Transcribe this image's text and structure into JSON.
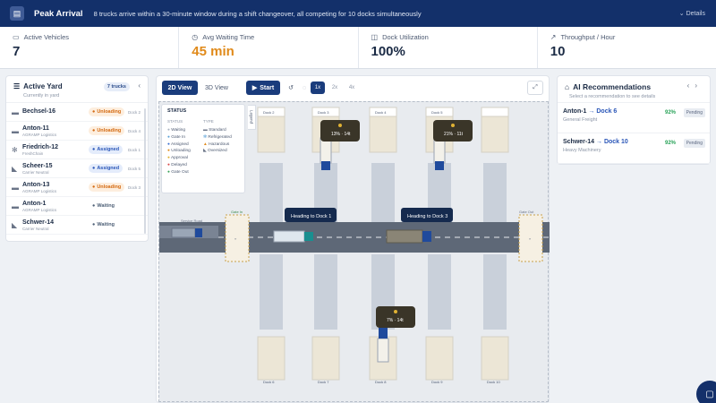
{
  "banner": {
    "title": "Peak Arrival",
    "text": "8 trucks arrive within a 30-minute window during a shift changeover, all competing for 10 docks simultaneously",
    "details": "Details"
  },
  "stats": [
    {
      "label": "Active Vehicles",
      "value": "7",
      "icon": "truck-icon"
    },
    {
      "label": "Avg Waiting Time",
      "value": "45 min",
      "icon": "clock-icon",
      "color": "#e08a1a"
    },
    {
      "label": "Dock Utilization",
      "value": "100%",
      "icon": "dock-icon"
    },
    {
      "label": "Throughput / Hour",
      "value": "10",
      "icon": "trend-icon"
    }
  ],
  "left_panel": {
    "title": "Active Yard",
    "subtitle": "Currently in yard",
    "badge": "7 trucks",
    "trucks": [
      {
        "name": "Bechsel-16",
        "company": "",
        "status": "Unloading",
        "dock": "Dock 2"
      },
      {
        "name": "Anton-11",
        "company": "AGRAMP Logistics",
        "status": "Unloading",
        "dock": "Dock 4"
      },
      {
        "name": "Friedrich-12",
        "company": "FreshChain",
        "status": "Assigned",
        "dock": "Dock 1"
      },
      {
        "name": "Scheer-15",
        "company": "Carrier Neutral",
        "status": "Assigned",
        "dock": "Dock 5"
      },
      {
        "name": "Anton-13",
        "company": "AGRAMP Logistics",
        "status": "Unloading",
        "dock": "Dock 3"
      },
      {
        "name": "Anton-1",
        "company": "AGRAMP Logistics",
        "status": "Waiting",
        "dock": ""
      },
      {
        "name": "Schwer-14",
        "company": "Carrier Neutral",
        "status": "Waiting",
        "dock": ""
      }
    ]
  },
  "toolbar": {
    "view_2d": "2D View",
    "view_3d": "3D View",
    "start": "Start",
    "speed_1": "1x",
    "speed_2": "2x",
    "speed_4": "4x"
  },
  "yard": {
    "legend_tab": "Legend",
    "legend_status_title": "STATUS",
    "legend_status_col": "STATUS",
    "legend_type_col": "TYPE",
    "statuses": [
      "Waiting",
      "Gate In",
      "Assigned",
      "Unloading",
      "Approval",
      "Delayed",
      "Gate Out"
    ],
    "types": [
      "Standard",
      "Refrigerated",
      "Hazardous",
      "Oversized"
    ],
    "top_docks": [
      "Dock 2",
      "Dock 3",
      "Dock 4",
      "Dock 5"
    ],
    "bottom_docks": [
      "Dock 6",
      "Dock 7",
      "Dock 8",
      "Dock 9",
      "Dock 10"
    ],
    "bubble_1": "13% · 14t",
    "bubble_2": "21% · 11t",
    "bubble_3": "7% · 14t",
    "heading_1": "Heading to Dock 1",
    "heading_2": "Heading to Dock 3",
    "gate_in": "Gate In",
    "gate_out": "Gate Out",
    "service_road": "Service Road"
  },
  "right_panel": {
    "title": "AI Recommendations",
    "subtitle": "Select a recommendation to see details",
    "recommendations": [
      {
        "truck": "Anton-1",
        "dock": "Dock 6",
        "cargo": "General Freight",
        "pct": "92%",
        "status": "Pending"
      },
      {
        "truck": "Schwer-14",
        "dock": "Dock 10",
        "cargo": "Heavy Machinery",
        "pct": "92%",
        "status": "Pending"
      }
    ]
  },
  "colors": {
    "banner": "#13306a",
    "accent": "#1a3c7c",
    "unloading": "#d46a12",
    "assigned": "#2a56b8",
    "pct": "#2aa35a"
  }
}
